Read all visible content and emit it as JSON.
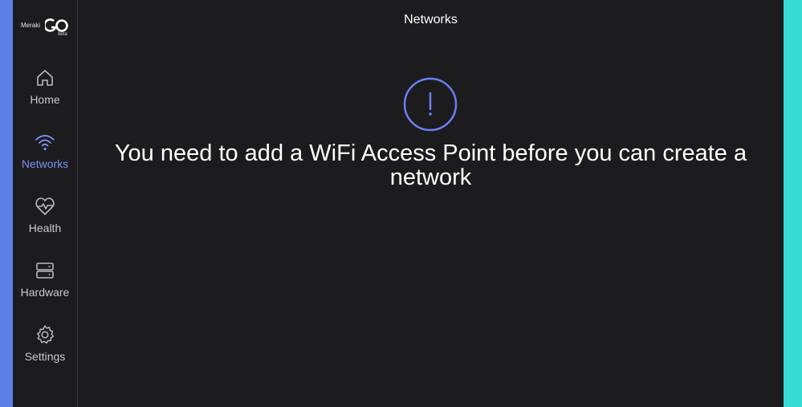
{
  "logo": {
    "brand": "Meraki",
    "product": "GO",
    "tag": "beta"
  },
  "colors": {
    "accent": "#6b7ff0",
    "left_strip": "#5b7fe6",
    "right_strip": "#37dcd5",
    "background": "#1c1c1e"
  },
  "sidebar": {
    "items": [
      {
        "label": "Home",
        "icon": "home-icon",
        "active": false
      },
      {
        "label": "Networks",
        "icon": "wifi-icon",
        "active": true
      },
      {
        "label": "Health",
        "icon": "heart-pulse-icon",
        "active": false
      },
      {
        "label": "Hardware",
        "icon": "server-icon",
        "active": false
      },
      {
        "label": "Settings",
        "icon": "gear-icon",
        "active": false
      }
    ]
  },
  "header": {
    "title": "Networks"
  },
  "empty_state": {
    "icon": "alert-circle-icon",
    "message": "You need to add a WiFi Access Point before you can create a network"
  }
}
